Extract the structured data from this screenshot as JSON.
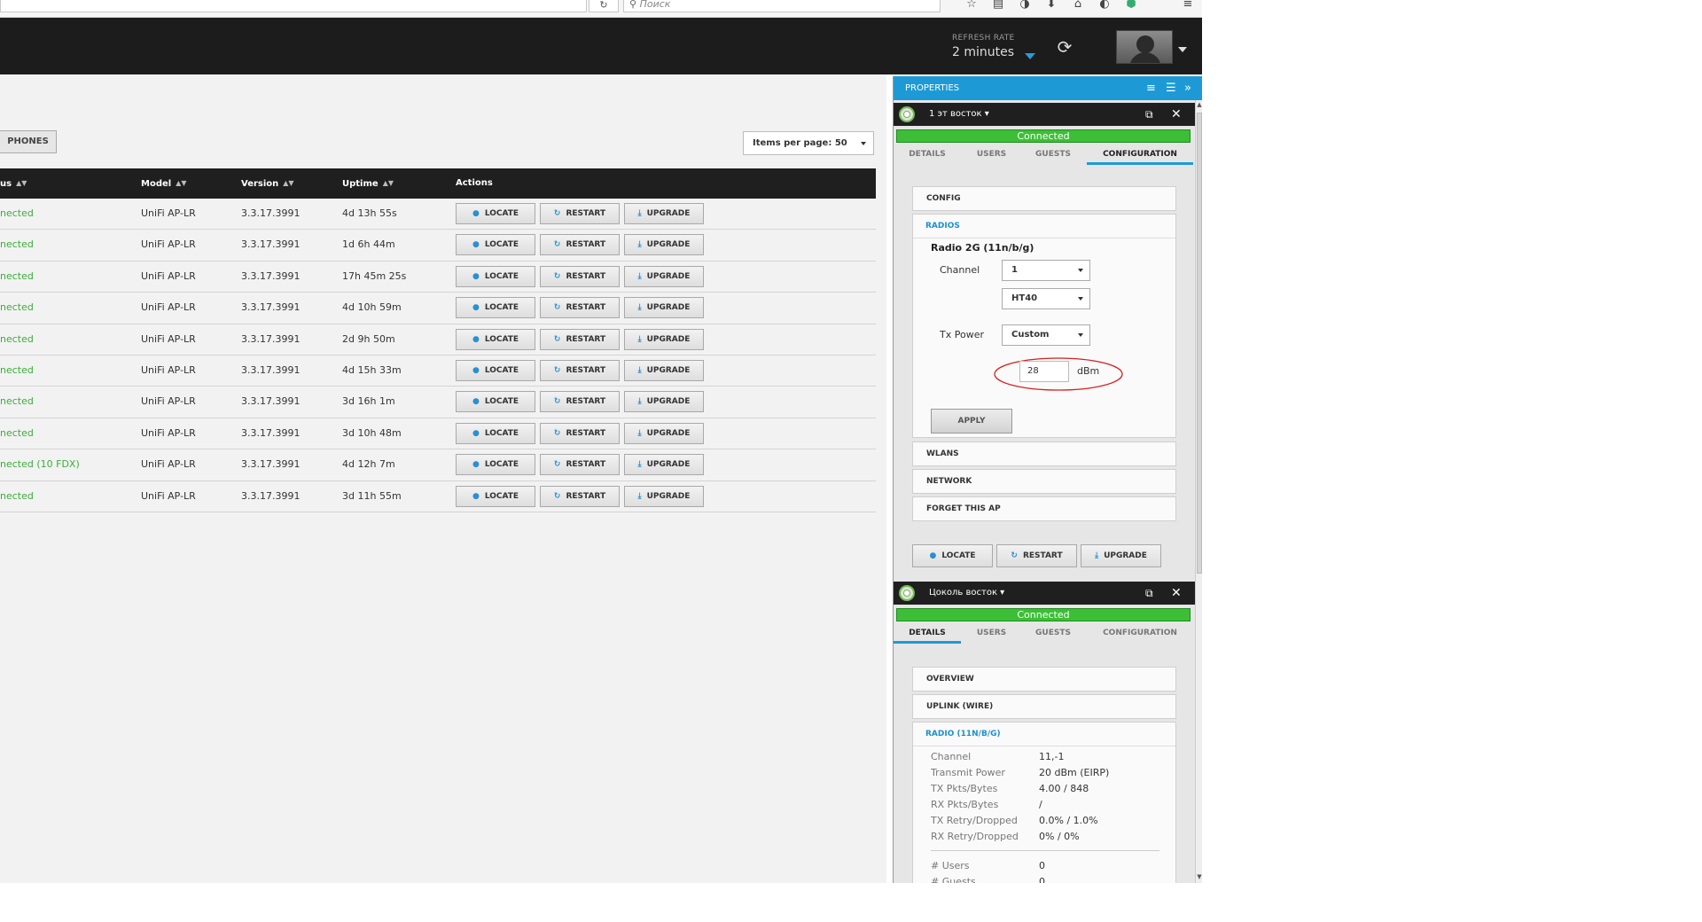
{
  "browser": {
    "reload_glyph": "↻",
    "search_placeholder": "Поиск",
    "icons": [
      "star-icon",
      "bookmarks-icon",
      "pocket-icon",
      "download-icon",
      "home-icon",
      "chat-icon",
      "extension-icon",
      "menu-icon"
    ]
  },
  "header": {
    "refresh_label": "REFRESH RATE",
    "refresh_value": "2 minutes",
    "accent": "#2b9bd8"
  },
  "toolbar": {
    "phones_label": "PHONES",
    "items_per_page": "Items per page: 50"
  },
  "table": {
    "columns": {
      "status": "us",
      "model": "Model",
      "version": "Version",
      "uptime": "Uptime",
      "actions": "Actions"
    },
    "action_labels": {
      "locate": "LOCATE",
      "restart": "RESTART",
      "upgrade": "UPGRADE"
    },
    "rows": [
      {
        "status": "nected",
        "model": "UniFi AP-LR",
        "version": "3.3.17.3991",
        "uptime": "4d 13h 55s"
      },
      {
        "status": "nected",
        "model": "UniFi AP-LR",
        "version": "3.3.17.3991",
        "uptime": "1d 6h 44m"
      },
      {
        "status": "nected",
        "model": "UniFi AP-LR",
        "version": "3.3.17.3991",
        "uptime": "17h 45m 25s"
      },
      {
        "status": "nected",
        "model": "UniFi AP-LR",
        "version": "3.3.17.3991",
        "uptime": "4d 10h 59m"
      },
      {
        "status": "nected",
        "model": "UniFi AP-LR",
        "version": "3.3.17.3991",
        "uptime": "2d 9h 50m"
      },
      {
        "status": "nected",
        "model": "UniFi AP-LR",
        "version": "3.3.17.3991",
        "uptime": "4d 15h 33m"
      },
      {
        "status": "nected",
        "model": "UniFi AP-LR",
        "version": "3.3.17.3991",
        "uptime": "3d 16h 1m"
      },
      {
        "status": "nected",
        "model": "UniFi AP-LR",
        "version": "3.3.17.3991",
        "uptime": "3d 10h 48m"
      },
      {
        "status": "nected (10 FDX)",
        "model": "UniFi AP-LR",
        "version": "3.3.17.3991",
        "uptime": "4d 12h 7m"
      },
      {
        "status": "nected",
        "model": "UniFi AP-LR",
        "version": "3.3.17.3991",
        "uptime": "3d 11h 55m"
      }
    ],
    "status_color": "#3bae3b"
  },
  "properties": {
    "title": "PROPERTIES",
    "accent": "#1d9ad6",
    "ap1": {
      "name": "1 эт восток ▾",
      "connection": "Connected",
      "tabs": [
        "DETAILS",
        "USERS",
        "GUESTS",
        "CONFIGURATION"
      ],
      "active_tab": "CONFIGURATION",
      "config_label": "CONFIG",
      "radios_label": "RADIOS",
      "radio_title": "Radio 2G (11n/b/g)",
      "channel_label": "Channel",
      "channel_value": "1",
      "width_value": "HT40",
      "txpower_label": "Tx Power",
      "txpower_value": "Custom",
      "dbm_value": "28",
      "dbm_unit": "dBm",
      "apply_label": "APPLY",
      "wlans_label": "WLANS",
      "network_label": "NETWORK",
      "forget_label": "FORGET THIS AP",
      "locate": "LOCATE",
      "restart": "RESTART",
      "upgrade": "UPGRADE"
    },
    "ap2": {
      "name": "Цоколь восток ▾",
      "connection": "Connected",
      "tabs": [
        "DETAILS",
        "USERS",
        "GUESTS",
        "CONFIGURATION"
      ],
      "active_tab": "DETAILS",
      "overview_label": "OVERVIEW",
      "uplink_label": "UPLINK (WIRE)",
      "radio_label": "RADIO (11N/B/G)",
      "details": [
        {
          "label": "Channel",
          "value": "11,-1"
        },
        {
          "label": "Transmit Power",
          "value": "20 dBm (EIRP)"
        },
        {
          "label": "TX Pkts/Bytes",
          "value": "4.00 / 848"
        },
        {
          "label": "RX Pkts/Bytes",
          "value": "/"
        },
        {
          "label": "TX Retry/Dropped",
          "value": "0.0% / 1.0%"
        },
        {
          "label": "RX Retry/Dropped",
          "value": "0% / 0%"
        }
      ],
      "users_label": "# Users",
      "users_value": "0",
      "guests_label": "# Guests",
      "guests_value": "0"
    }
  }
}
